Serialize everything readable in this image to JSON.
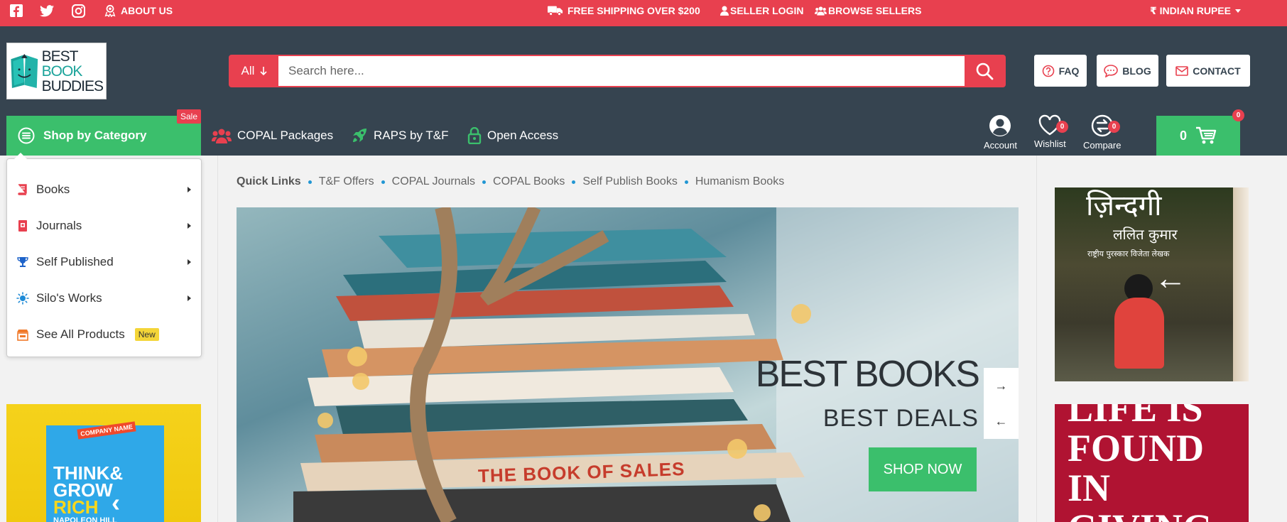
{
  "topbar": {
    "about_label": "ABOUT US",
    "shipping_label": "FREE SHIPPING OVER $200",
    "seller_login_label": "SELLER LOGIN",
    "browse_sellers_label": "BROWSE SELLERS",
    "currency_label": "₹ INDIAN RUPEE"
  },
  "logo": {
    "line1": "BEST",
    "line2": "BOOK",
    "line3": "BUDDIES"
  },
  "search": {
    "category": "All",
    "placeholder": "Search here..."
  },
  "header_buttons": {
    "faq": "FAQ",
    "blog": "BLOG",
    "contact": "CONTACT"
  },
  "nav": {
    "shop_by_category": "Shop by Category",
    "sale_badge": "Sale",
    "links": [
      "COPAL Packages",
      "RAPS by T&F",
      "Open Access"
    ],
    "account": "Account",
    "wishlist": "Wishlist",
    "wishlist_count": "0",
    "compare": "Compare",
    "compare_count": "0",
    "cart_total": "0",
    "cart_count": "0"
  },
  "categories": [
    {
      "label": "Books"
    },
    {
      "label": "Journals"
    },
    {
      "label": "Self Published"
    },
    {
      "label": "Silo's Works"
    },
    {
      "label": "See All Products",
      "tag": "New"
    }
  ],
  "quick_links": {
    "label": "Quick Links",
    "items": [
      "T&F Offers",
      "COPAL Journals",
      "COPAL Books",
      "Self Publish Books",
      "Humanism Books"
    ]
  },
  "hero": {
    "title": "BEST BOOKS",
    "subtitle": "BEST DEALS",
    "cta": "SHOP NOW",
    "spine_text": "THE BOOK OF SALES"
  },
  "left_banner": {
    "company": "COMPANY NAME",
    "line1": "THINK&",
    "line2": "GROW",
    "line3": "RICH",
    "author": "NAPOLEON HILL"
  },
  "right_banners": {
    "hindi_title": "ज़िन्दगी",
    "hindi_author": "ललित कुमार",
    "hindi_tagline": "राष्ट्रीय पुरस्कार विजेता लेखक",
    "english_text": "LIFE IS FOUND IN GIVING"
  },
  "colors": {
    "accent": "#e8404f",
    "header": "#364450",
    "green": "#3bbf6c"
  }
}
